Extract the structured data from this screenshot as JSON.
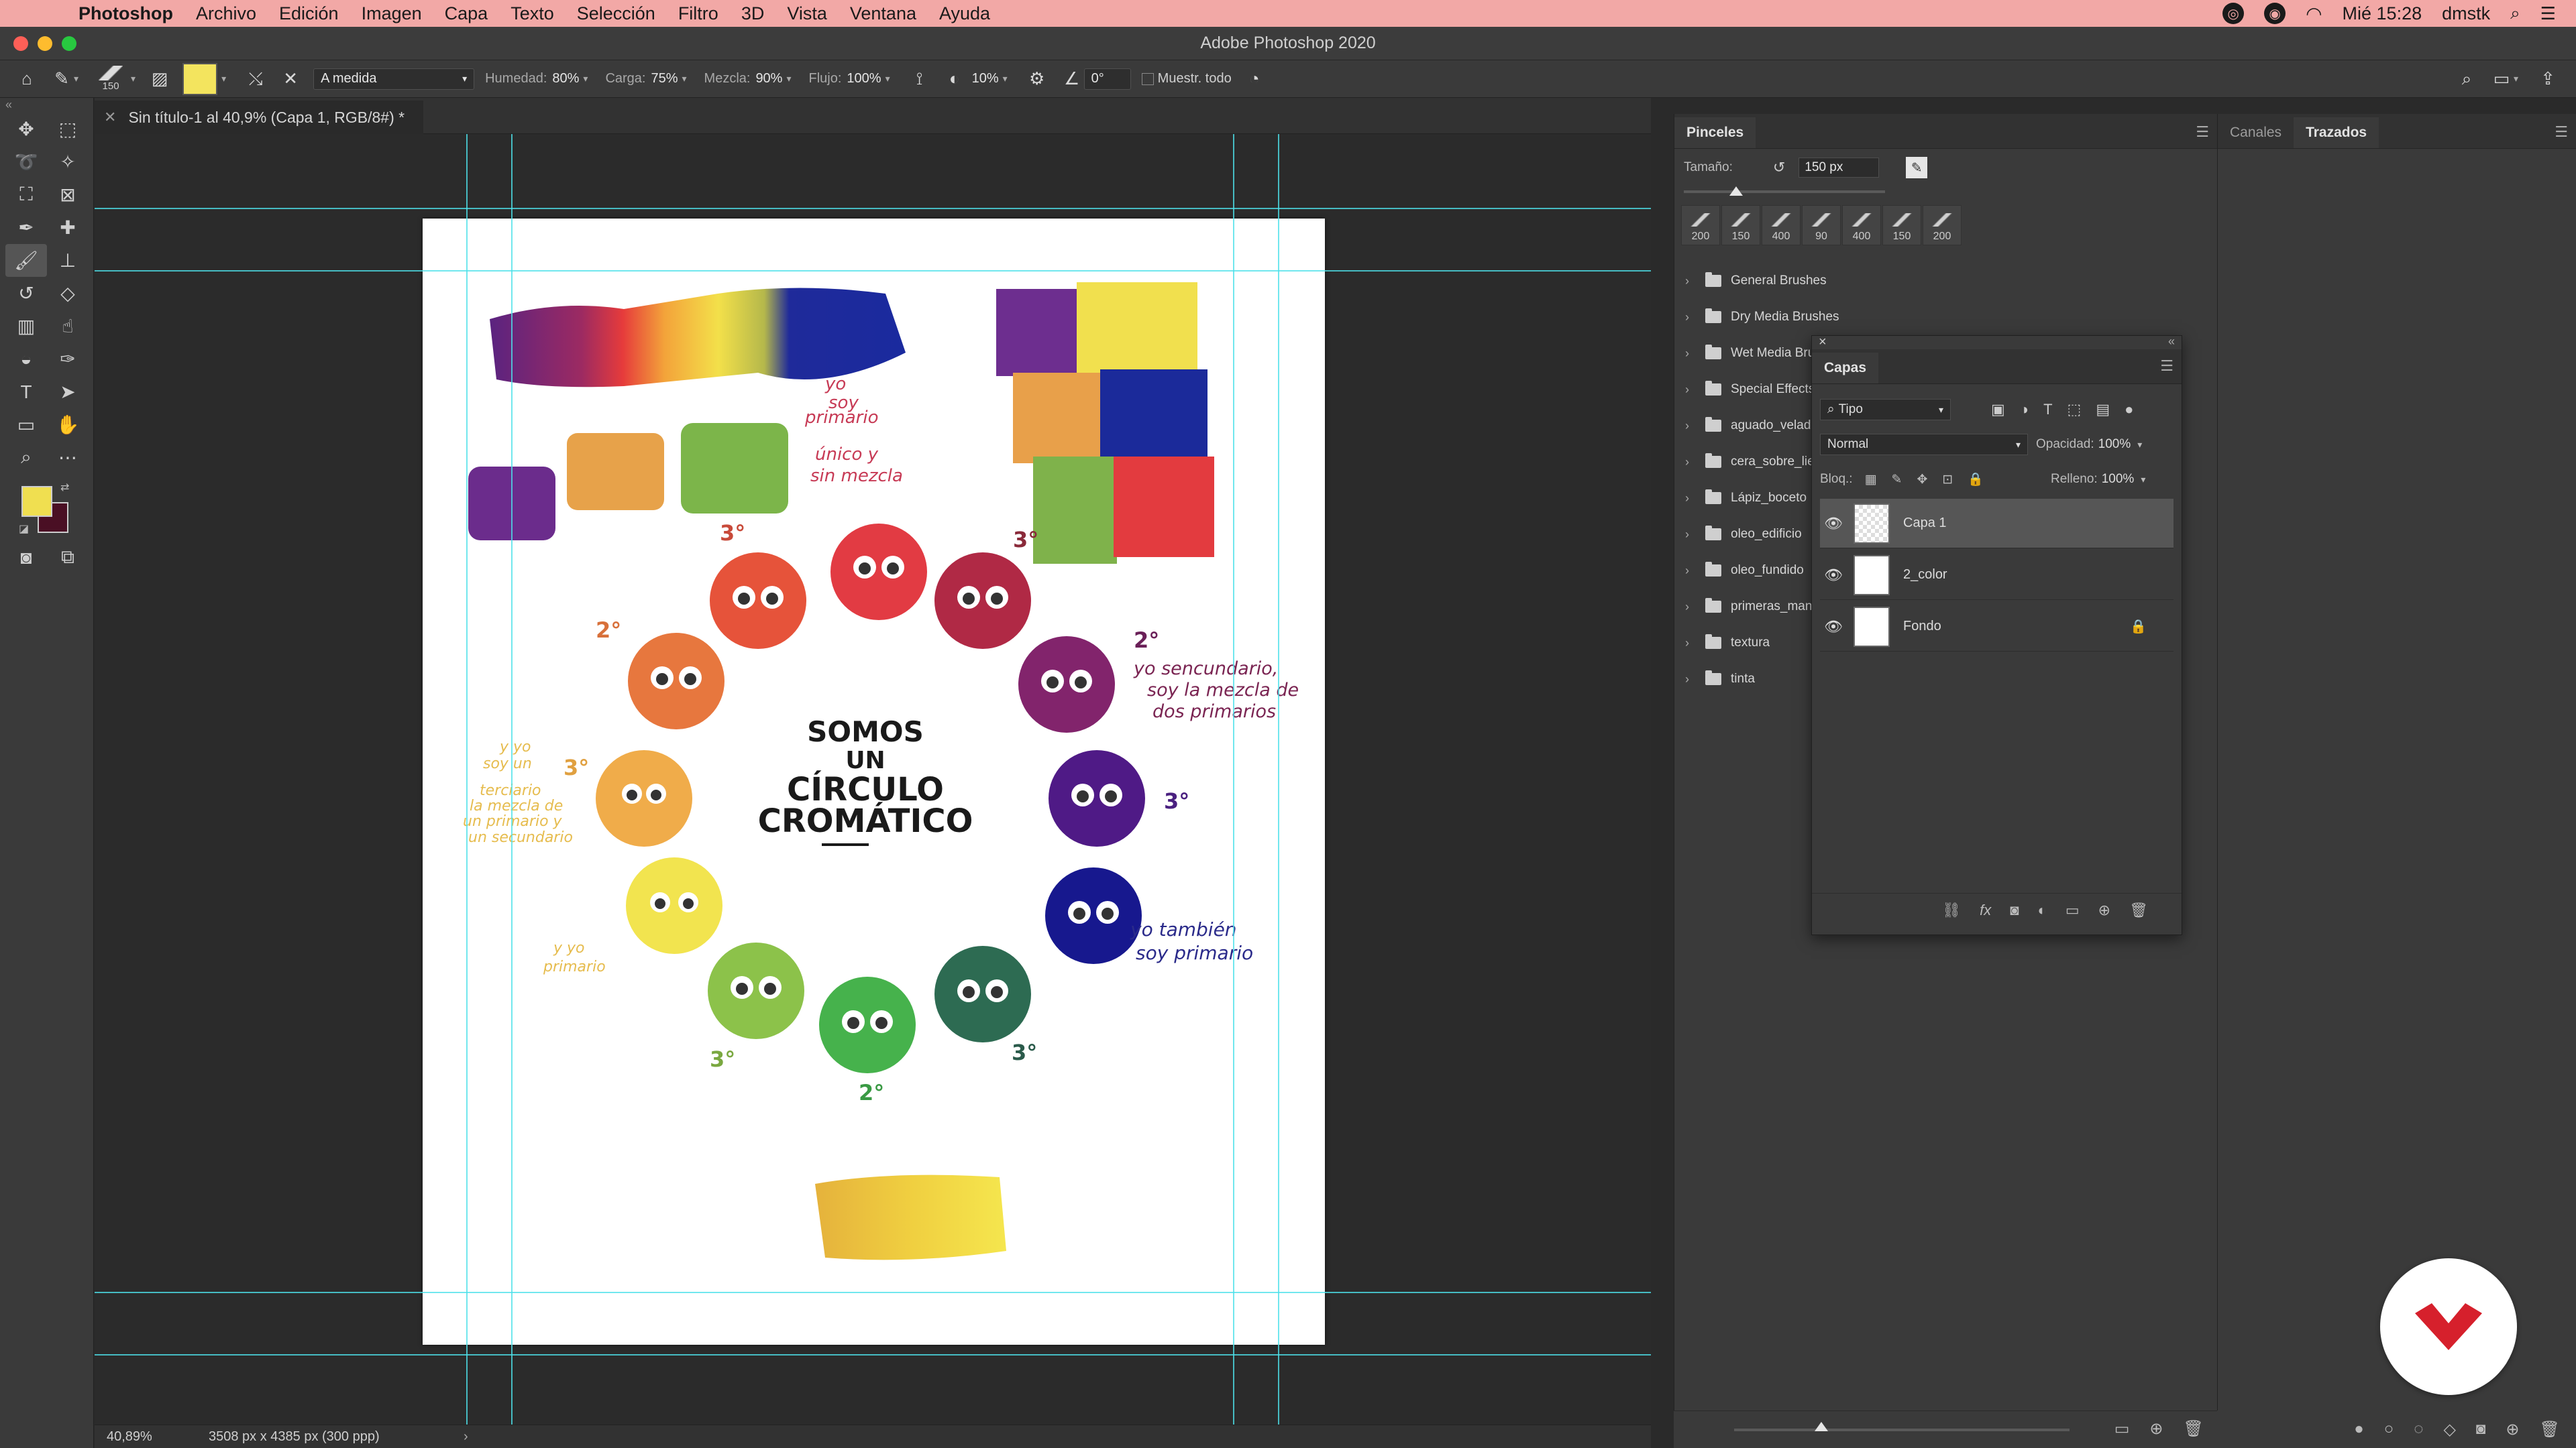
{
  "menubar": {
    "items": [
      "Photoshop",
      "Archivo",
      "Edición",
      "Imagen",
      "Capa",
      "Texto",
      "Selección",
      "Filtro",
      "3D",
      "Vista",
      "Ventana",
      "Ayuda"
    ],
    "clock": "Mié 15:28",
    "user": "dmstk",
    "bg_color": "#f2a8a6"
  },
  "window": {
    "title": "Adobe Photoshop 2020"
  },
  "options": {
    "brush_size": "150",
    "mode": "A medida",
    "humedad_label": "Humedad:",
    "humedad": "80%",
    "carga_label": "Carga:",
    "carga": "75%",
    "mezcla_label": "Mezcla:",
    "mezcla": "90%",
    "flujo_label": "Flujo:",
    "flujo": "100%",
    "suavizado": "10%",
    "angulo": "0°",
    "muestrear_label": "Muestr. todo",
    "swatch_color": "#f3e45e"
  },
  "document": {
    "tab_title": "Sin título-1 al 40,9% (Capa 1, RGB/8#) *",
    "zoom": "40,89%",
    "doc_info": "3508 px x 4385 px (300 ppp)"
  },
  "artwork": {
    "title_lines": [
      "SOMOS",
      "UN",
      "CÍRCULO",
      "CROMÁTICO"
    ],
    "note_primary_top": [
      "yo",
      "soy",
      "primario"
    ],
    "note_unique": [
      "único y",
      "sin mezcla"
    ],
    "note_secondary": [
      "yo sencundario,",
      "soy la mezcla de",
      "dos primarios"
    ],
    "note_tertiary": [
      "y yo",
      "soy un",
      "terciario",
      "la mezcla de",
      "un primario y",
      "un secundario"
    ],
    "note_primary_left": [
      "y yo",
      "primario"
    ],
    "note_primary_right": [
      "yo también",
      "soy primario"
    ],
    "labels": [
      "3°",
      "3°",
      "2°",
      "2°",
      "3°",
      "3°",
      "3°",
      "3°",
      "2°"
    ]
  },
  "brushes_panel": {
    "tab": "Pinceles",
    "size_label": "Tamaño:",
    "size_value": "150 px",
    "size_fraction": 0.26,
    "presets": [
      "200",
      "150",
      "400",
      "90",
      "400",
      "150",
      "200"
    ],
    "folders": [
      "General Brushes",
      "Dry Media Brushes",
      "Wet Media Brushes",
      "Special Effects",
      "aguado_velado",
      "cera_sobre_lienzo",
      "Lápiz_boceto",
      "oleo_edificio",
      "oleo_fundido",
      "primeras_manchas",
      "textura",
      "tinta"
    ]
  },
  "paths_panel": {
    "tabs": [
      "Canales",
      "Trazados"
    ]
  },
  "layers_panel": {
    "tab": "Capas",
    "filter": "Tipo",
    "blend": "Normal",
    "opacity_label": "Opacidad:",
    "opacity": "100%",
    "lock_label": "Bloq.:",
    "fill_label": "Relleno:",
    "fill": "100%",
    "layers": [
      "Capa 1",
      "2_color",
      "Fondo"
    ]
  }
}
